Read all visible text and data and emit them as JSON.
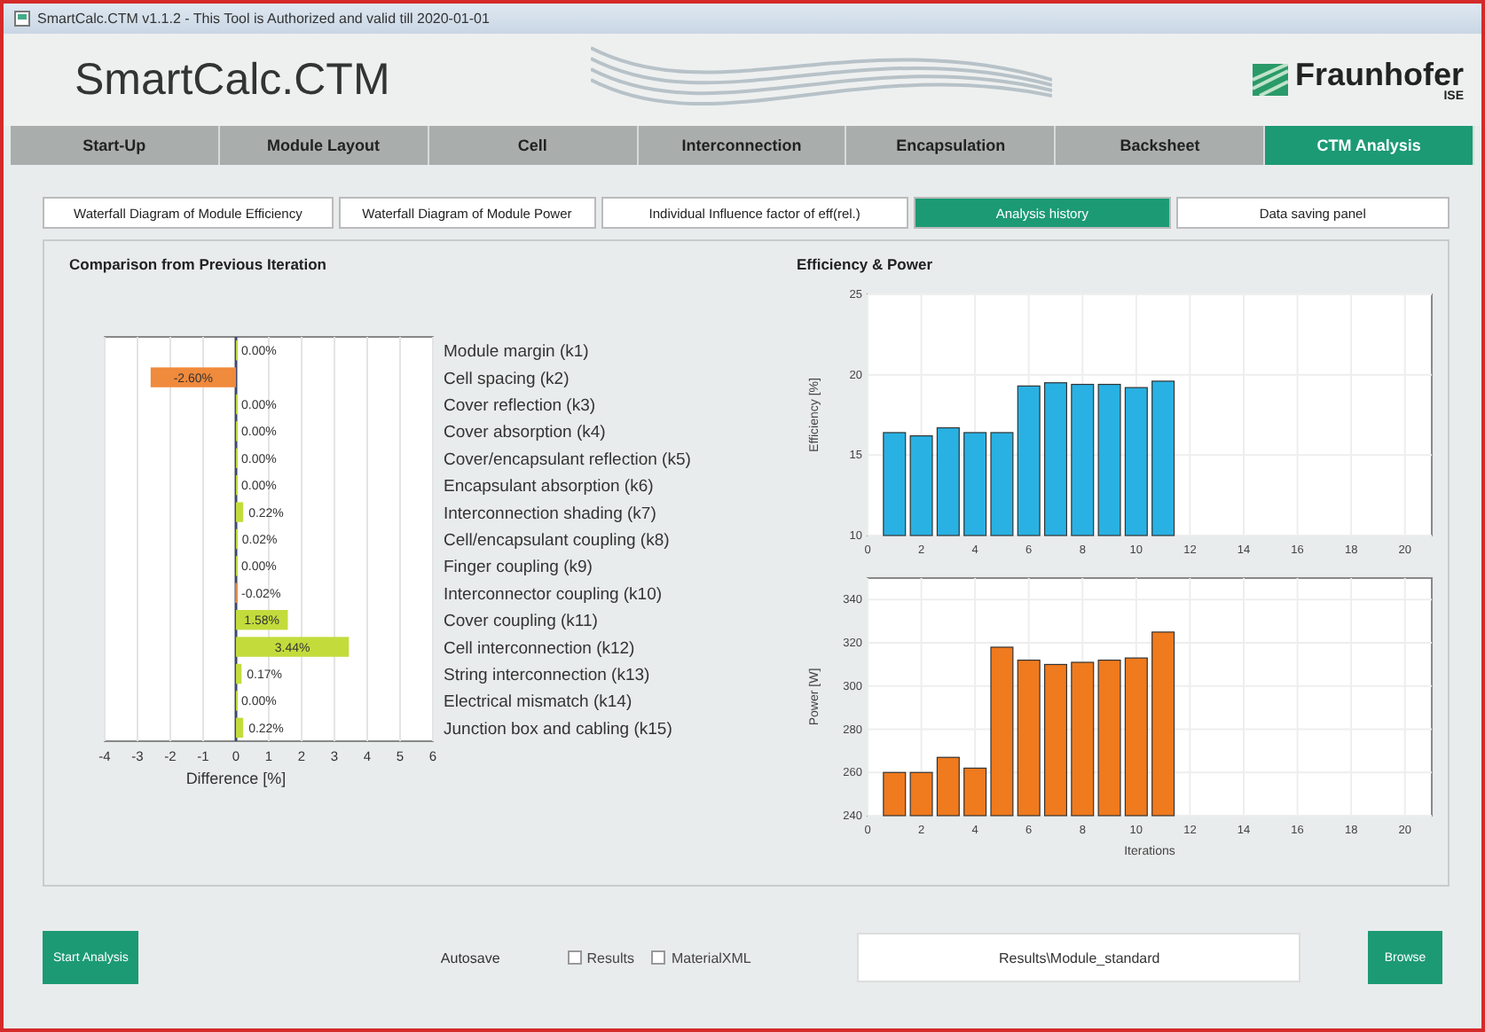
{
  "window": {
    "title": "SmartCalc.CTM v1.1.2 - This Tool is Authorized and valid till 2020-01-01"
  },
  "header": {
    "app_name": "SmartCalc.CTM",
    "logo_text": "Fraunhofer",
    "logo_subtext": "ISE"
  },
  "tabs": [
    {
      "label": "Start-Up",
      "selected": false
    },
    {
      "label": "Module Layout",
      "selected": false
    },
    {
      "label": "Cell",
      "selected": false
    },
    {
      "label": "Interconnection",
      "selected": false
    },
    {
      "label": "Encapsulation",
      "selected": false
    },
    {
      "label": "Backsheet",
      "selected": false
    },
    {
      "label": "CTM Analysis",
      "selected": true
    }
  ],
  "subtabs": [
    {
      "label": "Waterfall Diagram of Module Efficiency",
      "selected": false
    },
    {
      "label": "Waterfall Diagram of Module Power",
      "selected": false
    },
    {
      "label": "Individual Influence factor of eff(rel.)",
      "selected": false
    },
    {
      "label": "Analysis history",
      "selected": true
    },
    {
      "label": "Data saving panel",
      "selected": false
    }
  ],
  "comparison": {
    "title": "Comparison from Previous Iteration",
    "chart_data": {
      "type": "bar",
      "orientation": "horizontal",
      "xlabel": "Difference [%]",
      "categories": [
        "Module margin (k1)",
        "Cell spacing (k2)",
        "Cover reflection (k3)",
        "Cover absorption (k4)",
        "Cover/encapsulant reflection (k5)",
        "Encapsulant absorption (k6)",
        "Interconnection shading (k7)",
        "Cell/encapsulant coupling (k8)",
        "Finger coupling (k9)",
        "Interconnector coupling (k10)",
        "Cover coupling (k11)",
        "Cell interconnection (k12)",
        "String interconnection (k13)",
        "Electrical mismatch (k14)",
        "Junction box and cabling (k15)"
      ],
      "values": [
        0.0,
        -2.6,
        0.0,
        0.0,
        0.0,
        0.0,
        0.22,
        0.02,
        0.0,
        -0.02,
        1.58,
        3.44,
        0.17,
        0.0,
        0.22
      ],
      "grid": true,
      "ref_lines": [
        {
          "axis": "x",
          "value": 0
        }
      ],
      "value_labels": [
        "0.00%",
        "-2.60%",
        "0.00%",
        "0.00%",
        "0.00%",
        "0.00%",
        "0.22%",
        "0.02%",
        "0.00%",
        "-0.02%",
        "1.58%",
        "3.44%",
        "0.17%",
        "0.00%",
        "0.22%"
      ],
      "xlim": [
        -4,
        6
      ],
      "xticks": [
        -4,
        -3,
        -2,
        -1,
        0,
        1,
        2,
        3,
        4,
        5,
        6
      ]
    }
  },
  "efficiency_power": {
    "title": "Efficiency & Power",
    "efficiency_chart": {
      "chart_data": {
        "type": "bar",
        "ylabel": "Efficiency [%]",
        "x": [
          1,
          2,
          3,
          4,
          5,
          6,
          7,
          8,
          9,
          10,
          11
        ],
        "values": [
          16.4,
          16.2,
          16.7,
          16.4,
          16.4,
          19.3,
          19.5,
          19.4,
          19.4,
          19.2,
          19.6
        ],
        "grid": true,
        "xlim": [
          0,
          21
        ],
        "ylim": [
          10,
          25
        ],
        "xticks": [
          0,
          2,
          4,
          6,
          8,
          10,
          12,
          14,
          16,
          18,
          20
        ],
        "yticks": [
          10,
          15,
          20,
          25
        ]
      }
    },
    "power_chart": {
      "chart_data": {
        "type": "bar",
        "xlabel": "Iterations",
        "ylabel": "Power [W]",
        "x": [
          1,
          2,
          3,
          4,
          5,
          6,
          7,
          8,
          9,
          10,
          11
        ],
        "values": [
          260,
          260,
          267,
          262,
          318,
          312,
          310,
          311,
          312,
          313,
          325
        ],
        "grid": true,
        "xlim": [
          0,
          21
        ],
        "ylim": [
          240,
          350
        ],
        "xticks": [
          0,
          2,
          4,
          6,
          8,
          10,
          12,
          14,
          16,
          18,
          20
        ],
        "yticks": [
          240,
          260,
          280,
          300,
          320,
          340
        ]
      }
    }
  },
  "bottom_bar": {
    "start_button": "Start Analysis",
    "autosave_label": "Autosave",
    "checkboxes": [
      {
        "label": "Results",
        "checked": false
      },
      {
        "label": "MaterialXML",
        "checked": false
      }
    ],
    "path_field": {
      "value": "Results\\Module_standard"
    },
    "browse_button": "Browse"
  }
}
